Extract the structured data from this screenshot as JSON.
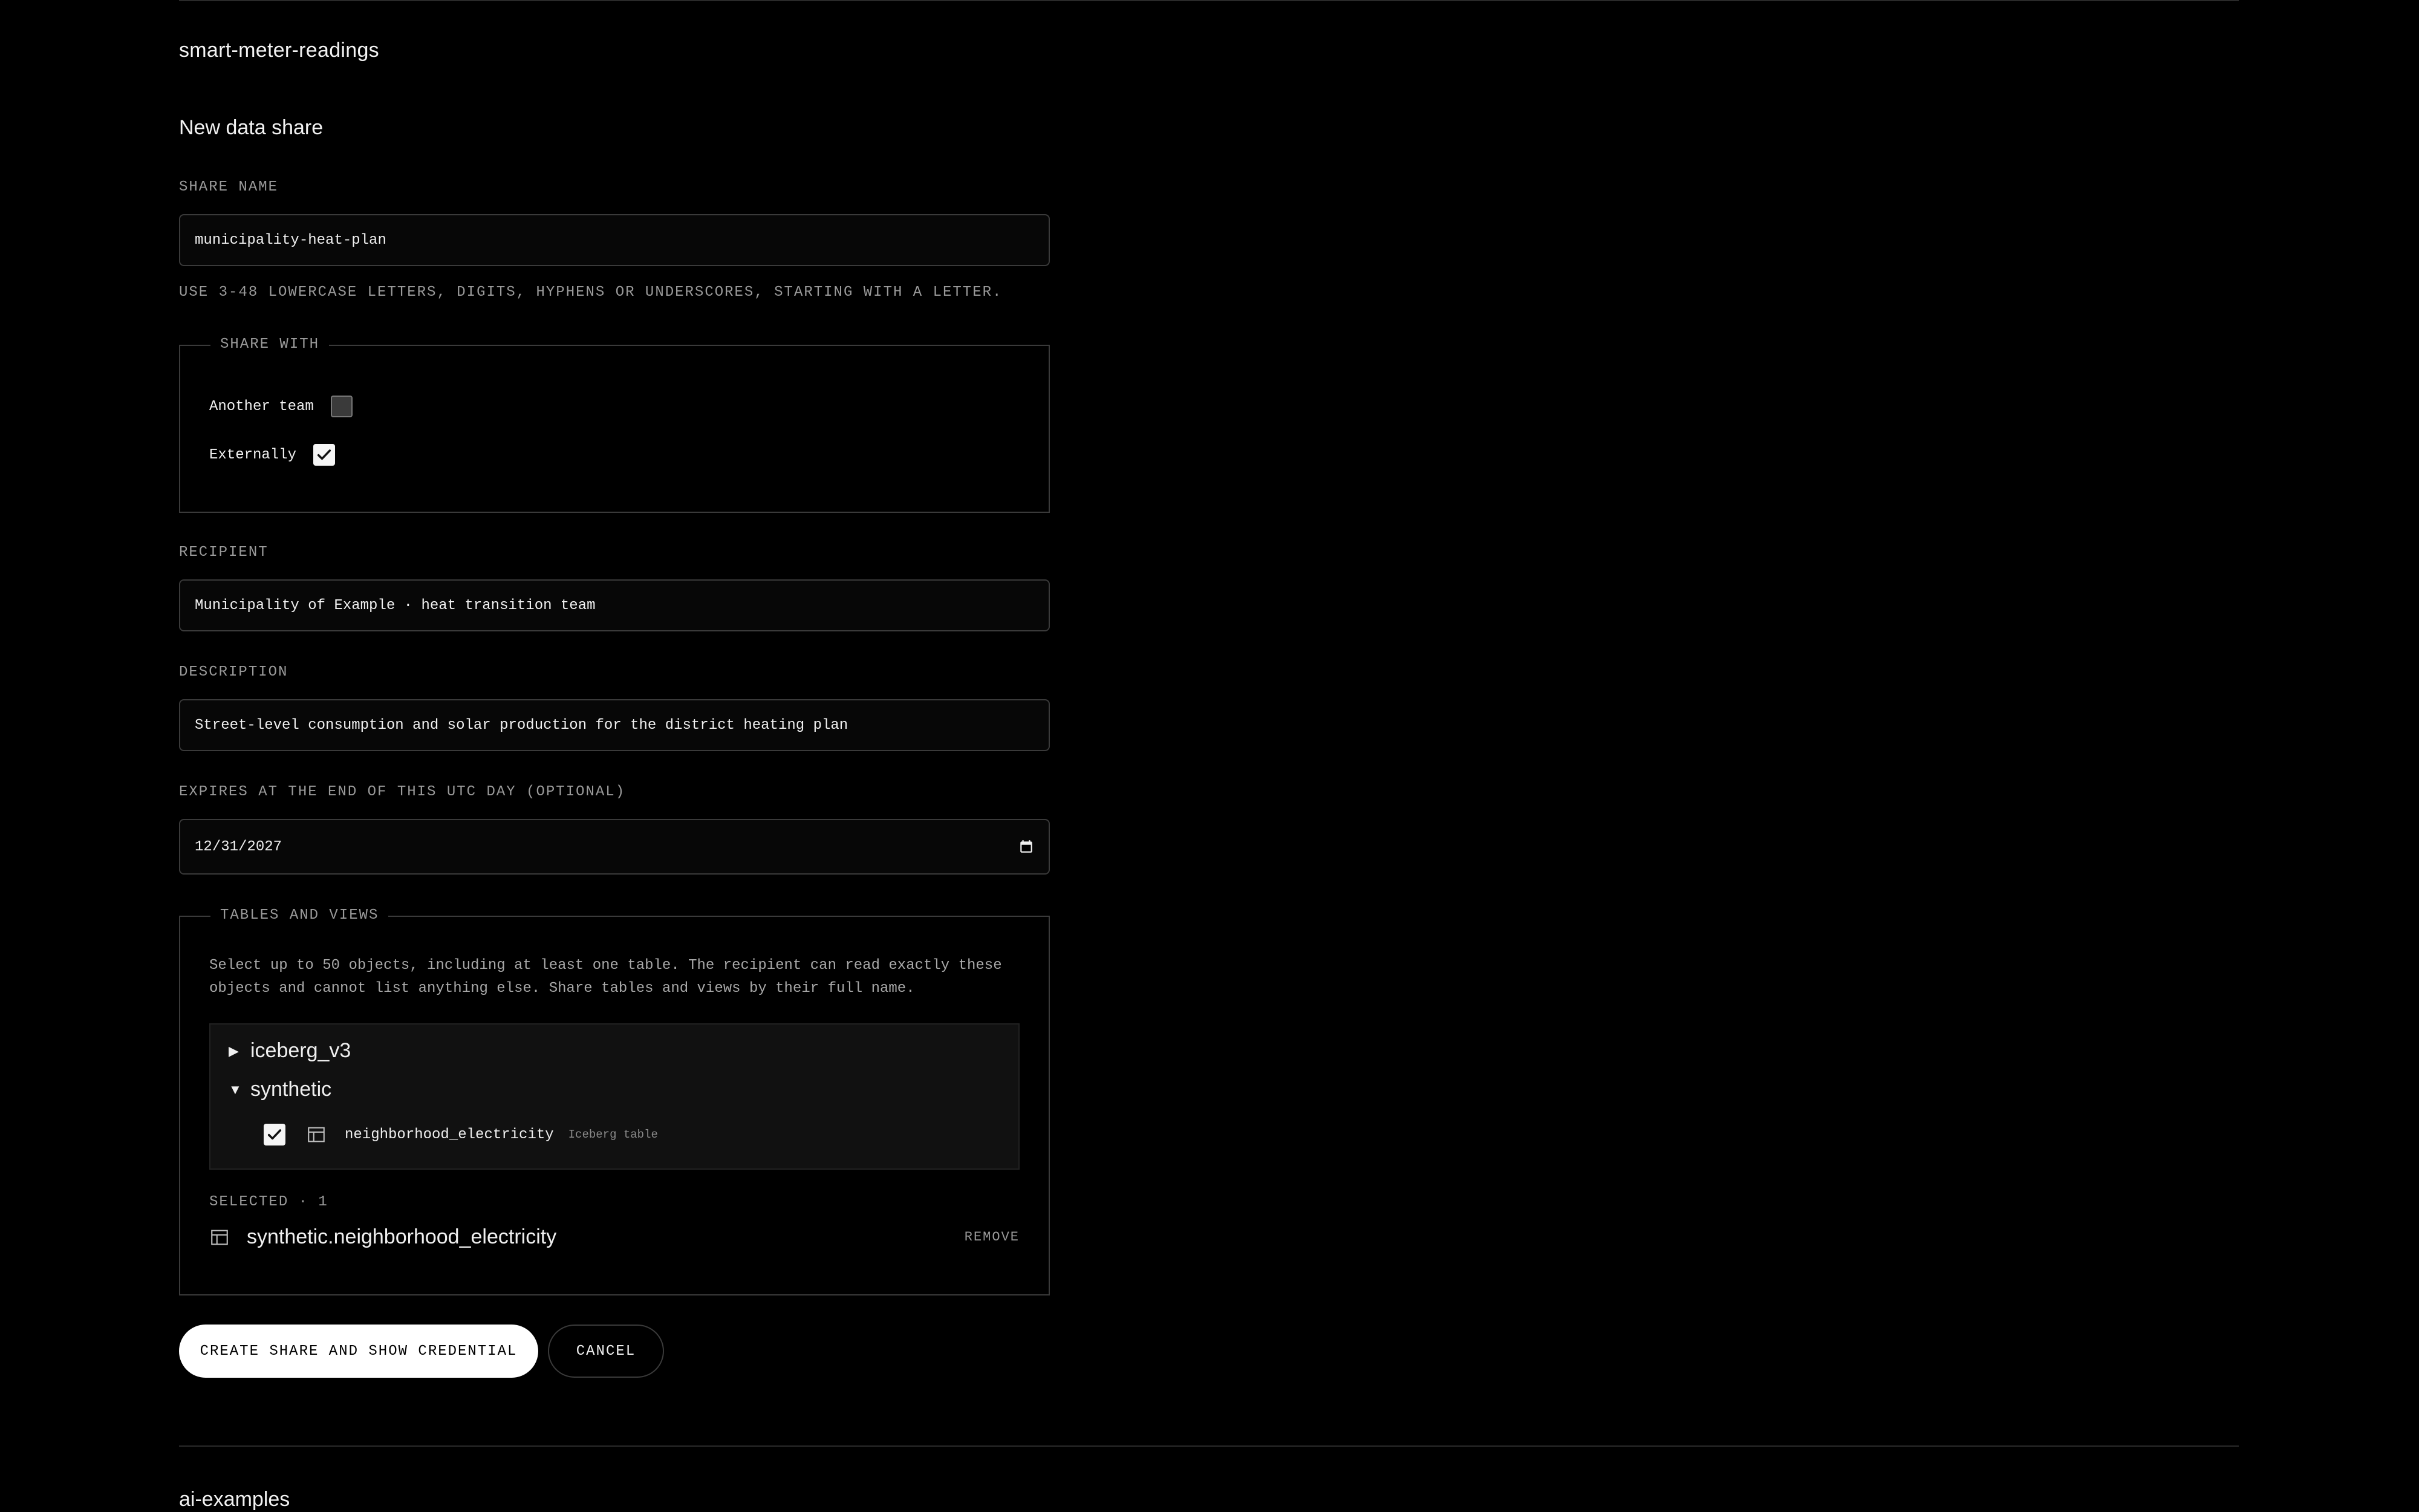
{
  "project": {
    "name": "smart-meter-readings"
  },
  "form": {
    "title": "New data share",
    "share_name": {
      "label": "SHARE NAME",
      "value": "municipality-heat-plan",
      "hint": "USE 3-48 LOWERCASE LETTERS, DIGITS, HYPHENS OR UNDERSCORES, STARTING WITH A LETTER."
    },
    "share_with": {
      "legend": "SHARE WITH",
      "options": [
        {
          "label": "Another team",
          "checked": false
        },
        {
          "label": "Externally",
          "checked": true
        }
      ]
    },
    "recipient": {
      "label": "RECIPIENT",
      "value": "Municipality of Example · heat transition team"
    },
    "description": {
      "label": "DESCRIPTION",
      "value": "Street-level consumption and solar production for the district heating plan"
    },
    "expires": {
      "label": "EXPIRES AT THE END OF THIS UTC DAY (OPTIONAL)",
      "value": "12/31/2027",
      "icon": "calendar-icon"
    },
    "tables": {
      "legend": "TABLES AND VIEWS",
      "description": "Select up to 50 objects, including at least one table. The recipient can read exactly these objects and cannot list anything else. Share tables and views by their full name.",
      "tree": [
        {
          "name": "iceberg_v3",
          "expanded": false,
          "icon": "triangle-right-icon"
        },
        {
          "name": "synthetic",
          "expanded": true,
          "icon": "triangle-down-icon",
          "children": [
            {
              "name": "neighborhood_electricity",
              "tag": "Iceberg table",
              "checked": true,
              "icon": "table-icon"
            }
          ]
        }
      ],
      "selected_label": "SELECTED · 1",
      "selected": [
        {
          "name": "synthetic.neighborhood_electricity",
          "icon": "table-icon",
          "remove_label": "REMOVE"
        }
      ]
    },
    "actions": {
      "create_label": "CREATE SHARE AND SHOW CREDENTIAL",
      "cancel_label": "CANCEL"
    }
  },
  "next_project": {
    "name": "ai-examples"
  }
}
